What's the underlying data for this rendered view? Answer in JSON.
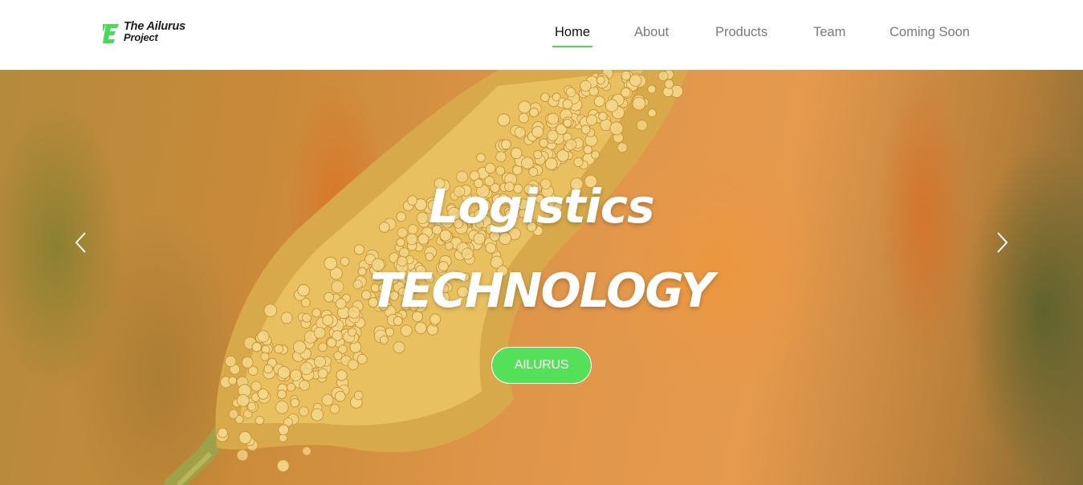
{
  "brand": {
    "line1": "The Ailurus",
    "line2": "Project",
    "accent_color": "#4cd95a",
    "icon": "ailurus-logo-icon"
  },
  "nav": {
    "items": [
      {
        "label": "Home",
        "active": true
      },
      {
        "label": "About",
        "active": false
      },
      {
        "label": "Products",
        "active": false
      },
      {
        "label": "Team",
        "active": false
      },
      {
        "label": "Coming Soon",
        "active": false
      }
    ]
  },
  "hero": {
    "title_line1": "Logistics",
    "title_line2": "TECHNOLOGY",
    "cta_label": "AILURUS",
    "cta_color": "#55e05a",
    "prev_icon": "chevron-left-icon",
    "next_icon": "chevron-right-icon"
  }
}
